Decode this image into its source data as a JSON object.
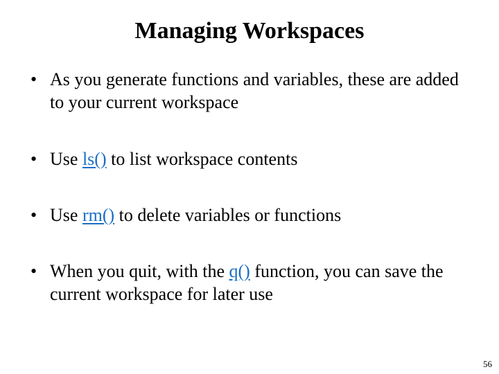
{
  "title": "Managing Workspaces",
  "bullets": [
    {
      "pre": "As you generate functions and variables, these are added to your current workspace",
      "fn": "",
      "post": ""
    },
    {
      "pre": "Use ",
      "fn": "ls()",
      "post": " to list workspace contents"
    },
    {
      "pre": "Use ",
      "fn": "rm()",
      "post": " to delete variables or functions"
    },
    {
      "pre": "When you quit, with the ",
      "fn": "q()",
      "post": " function, you can save the current workspace for later use"
    }
  ],
  "page_number": "56"
}
